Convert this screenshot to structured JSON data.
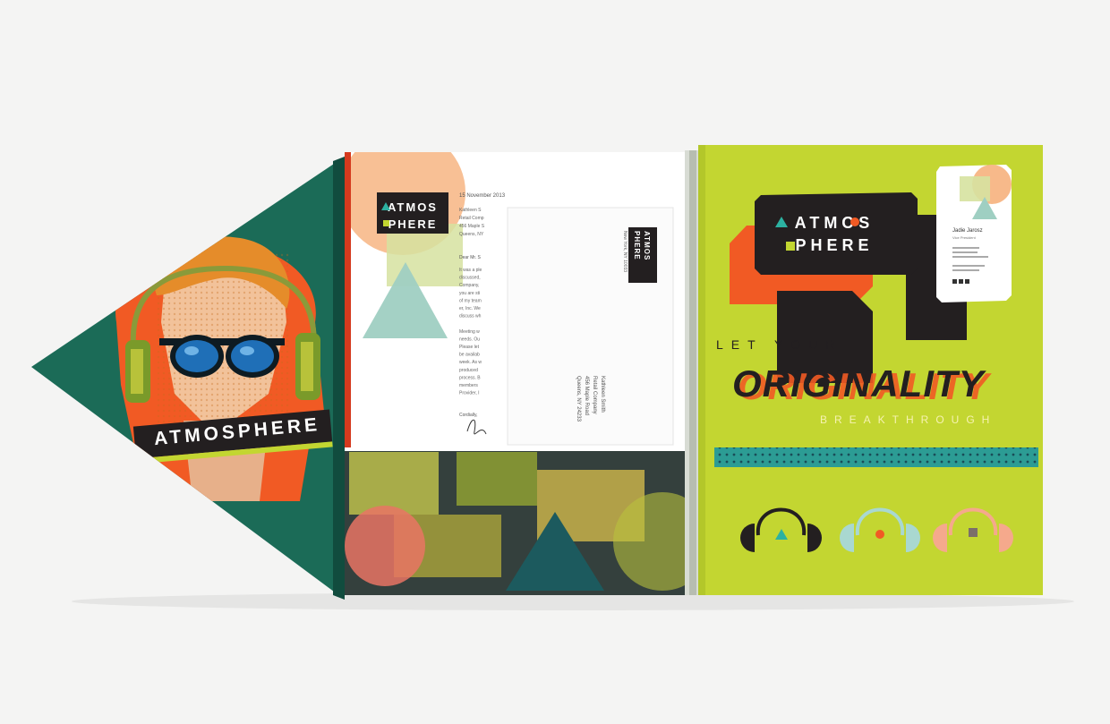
{
  "colors": {
    "background": "#f4f4f3",
    "teal_cover": "#1b6b57",
    "lime": "#c3d631",
    "orange": "#f15a24",
    "dark": "#231f20",
    "peach": "#f7b98a",
    "mint": "#9fcfc2"
  },
  "flap_sticker": {
    "brand": "ATMOSPHERE",
    "icons": [
      "headphones-icon",
      "sunglasses-icon"
    ]
  },
  "letterhead": {
    "logo_line1": "ATMOS",
    "logo_line2": "PHERE",
    "date": "15 November 2013",
    "recipient_lines": [
      "Kathleen S",
      "Retail Comp",
      "456 Maple S",
      "Queens, NY"
    ],
    "greeting": "Dear Mr. S",
    "body_lines": [
      "It was a ple",
      "discussed,",
      "Company,",
      "you are sti",
      "of my team",
      "er, Inc. We",
      "discuss wh",
      "",
      "Meeting w",
      "needs. Ou",
      "Please let",
      "be availab",
      "week. As w",
      "produced",
      "process. B",
      "members",
      "Provider, I"
    ],
    "closing": "Cordially,"
  },
  "envelope": {
    "logo_line1": "ATMOS",
    "logo_line2": "PHERE",
    "return_address": [
      "New York, NY 10033"
    ],
    "recipient": [
      "Kathleen Smith",
      "Retail Company",
      "456 Maple Road",
      "Queens, NY 24233"
    ]
  },
  "cover": {
    "headline_top": "LET YOUR",
    "headline_main": "ORIGINALITY",
    "headline_bottom": "BREAKTHROUGH",
    "business_card": {
      "logo_line1": "ATMOS",
      "logo_line2": "PHERE",
      "name": "Jadie Jarosz",
      "title": "Vice President"
    },
    "icons": [
      "headphones-icon",
      "headphones-icon",
      "headphones-icon"
    ]
  }
}
